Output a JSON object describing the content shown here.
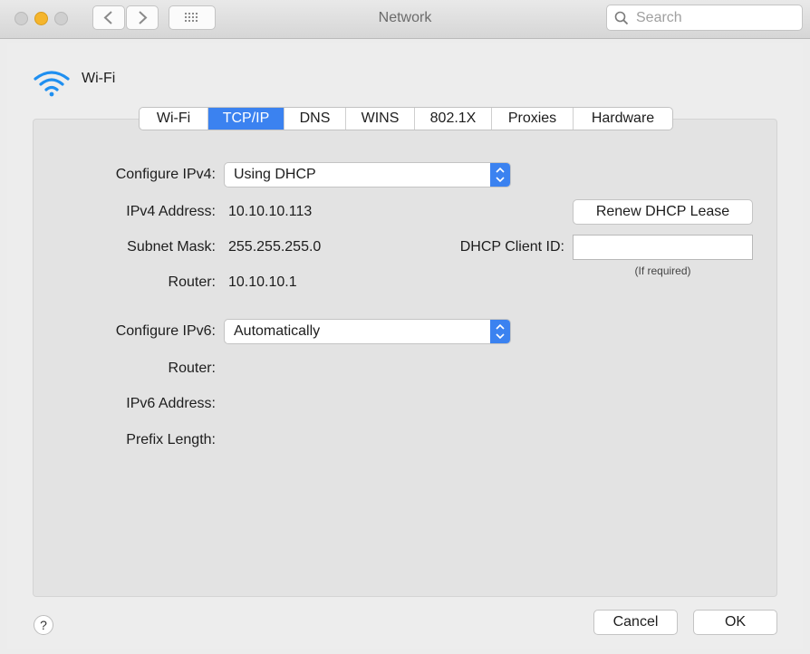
{
  "window": {
    "title": "Network"
  },
  "search": {
    "placeholder": "Search"
  },
  "service": {
    "name": "Wi-Fi"
  },
  "tabs": [
    {
      "label": "Wi-Fi",
      "active": false
    },
    {
      "label": "TCP/IP",
      "active": true
    },
    {
      "label": "DNS",
      "active": false
    },
    {
      "label": "WINS",
      "active": false
    },
    {
      "label": "802.1X",
      "active": false
    },
    {
      "label": "Proxies",
      "active": false
    },
    {
      "label": "Hardware",
      "active": false
    }
  ],
  "ipv4": {
    "configure_label": "Configure IPv4:",
    "configure_value": "Using DHCP",
    "address_label": "IPv4 Address:",
    "address_value": "10.10.10.113",
    "subnet_label": "Subnet Mask:",
    "subnet_value": "255.255.255.0",
    "router_label": "Router:",
    "router_value": "10.10.10.1",
    "renew_button": "Renew DHCP Lease",
    "client_id_label": "DHCP Client ID:",
    "client_id_value": "",
    "client_id_hint": "(If required)"
  },
  "ipv6": {
    "configure_label": "Configure IPv6:",
    "configure_value": "Automatically",
    "router_label": "Router:",
    "address_label": "IPv6 Address:",
    "prefix_label": "Prefix Length:"
  },
  "footer": {
    "help": "?",
    "cancel": "Cancel",
    "ok": "OK"
  },
  "colors": {
    "accent": "#3b82f0",
    "minimize": "#f5b52c"
  }
}
